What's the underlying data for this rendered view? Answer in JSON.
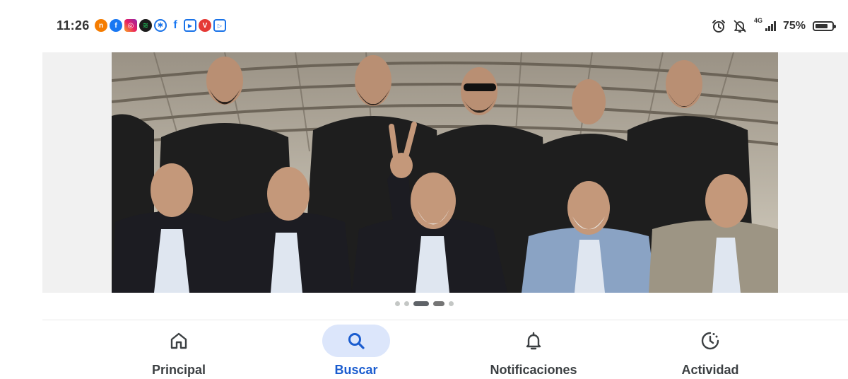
{
  "status_bar": {
    "time": "11:26",
    "battery_percent": "75%",
    "battery_level": 0.75,
    "network": "4G",
    "notification_icons": [
      "news-app-icon",
      "facebook-icon",
      "instagram-icon",
      "spotify-icon",
      "browser-icon",
      "facebook-lite-icon",
      "youtube-icon",
      "vivaldi-icon",
      "play-icon"
    ],
    "system_icons": [
      "alarm-icon",
      "notifications-off-icon",
      "signal-icon",
      "battery-icon"
    ]
  },
  "carousel": {
    "image_alt": "Group photo",
    "dot_count": 5,
    "active_index": 2
  },
  "bottom_nav": {
    "items": [
      {
        "label": "Principal",
        "icon": "home-icon",
        "active": false
      },
      {
        "label": "Buscar",
        "icon": "search-icon",
        "active": true
      },
      {
        "label": "Notificaciones",
        "icon": "bell-icon",
        "active": false
      },
      {
        "label": "Actividad",
        "icon": "activity-icon",
        "active": false
      }
    ]
  },
  "colors": {
    "accent": "#1a5ccf",
    "active_pill": "#dce6fb",
    "text": "#3c4043"
  }
}
